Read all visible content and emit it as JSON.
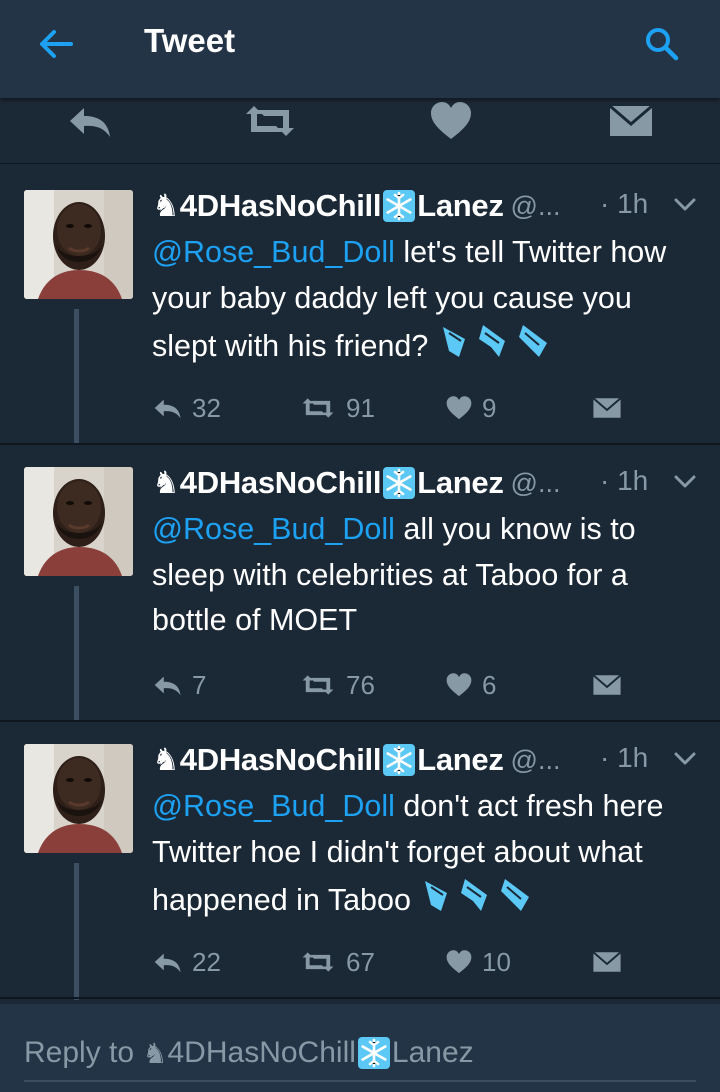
{
  "app": {
    "title": "Tweet"
  },
  "colors": {
    "background": "#1b2836",
    "appbar": "#243447",
    "accent": "#1da1f2",
    "muted": "#8899a6"
  },
  "top_actions": [
    "reply-icon",
    "retweet-icon",
    "like-icon",
    "message-icon"
  ],
  "tweets": [
    {
      "name": "4DHasNoChill",
      "name_suffix": "Lanez",
      "handle": "@...",
      "time": "· 1h",
      "mention": "@Rose_Bud_Doll",
      "text": " let's tell Twitter how your baby daddy left you cause you slept with his friend?",
      "has_emoji": true,
      "replies": "32",
      "retweets": "91",
      "likes": "9"
    },
    {
      "name": "4DHasNoChill",
      "name_suffix": "Lanez",
      "handle": "@...",
      "time": "· 1h",
      "mention": "@Rose_Bud_Doll",
      "text": " all you know is to sleep with celebrities at Taboo for a bottle of MOET",
      "has_emoji": false,
      "replies": "7",
      "retweets": "76",
      "likes": "6"
    },
    {
      "name": "4DHasNoChill",
      "name_suffix": "Lanez",
      "handle": "@...",
      "time": "· 1h",
      "mention": "@Rose_Bud_Doll",
      "text": " don't act fresh here Twitter hoe I didn't forget about what happened in Taboo",
      "has_emoji": true,
      "replies": "22",
      "retweets": "67",
      "likes": "10"
    }
  ],
  "reply": {
    "prefix": "Reply to ",
    "name": "4DHasNoChill",
    "name_suffix": "Lanez"
  }
}
